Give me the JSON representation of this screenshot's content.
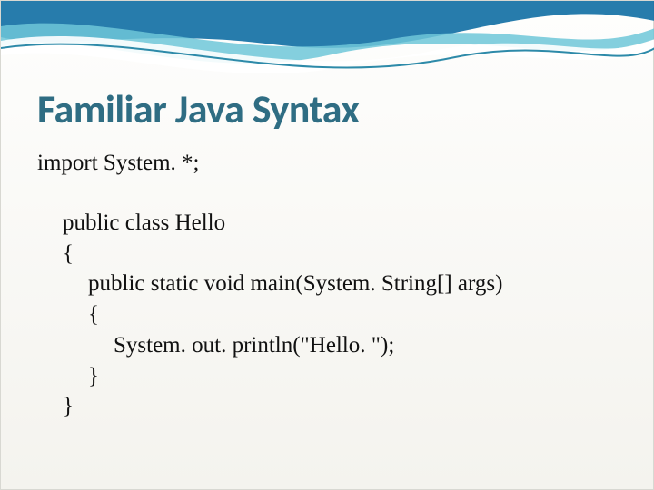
{
  "title": "Familiar Java Syntax",
  "code": {
    "l1": "import System. *;",
    "l2": "public class Hello",
    "l3": "{",
    "l4": "public static void main(System. String[] args)",
    "l5": "{",
    "l6": "System. out. println(\"Hello. \");",
    "l7": "}",
    "l8": "}"
  }
}
